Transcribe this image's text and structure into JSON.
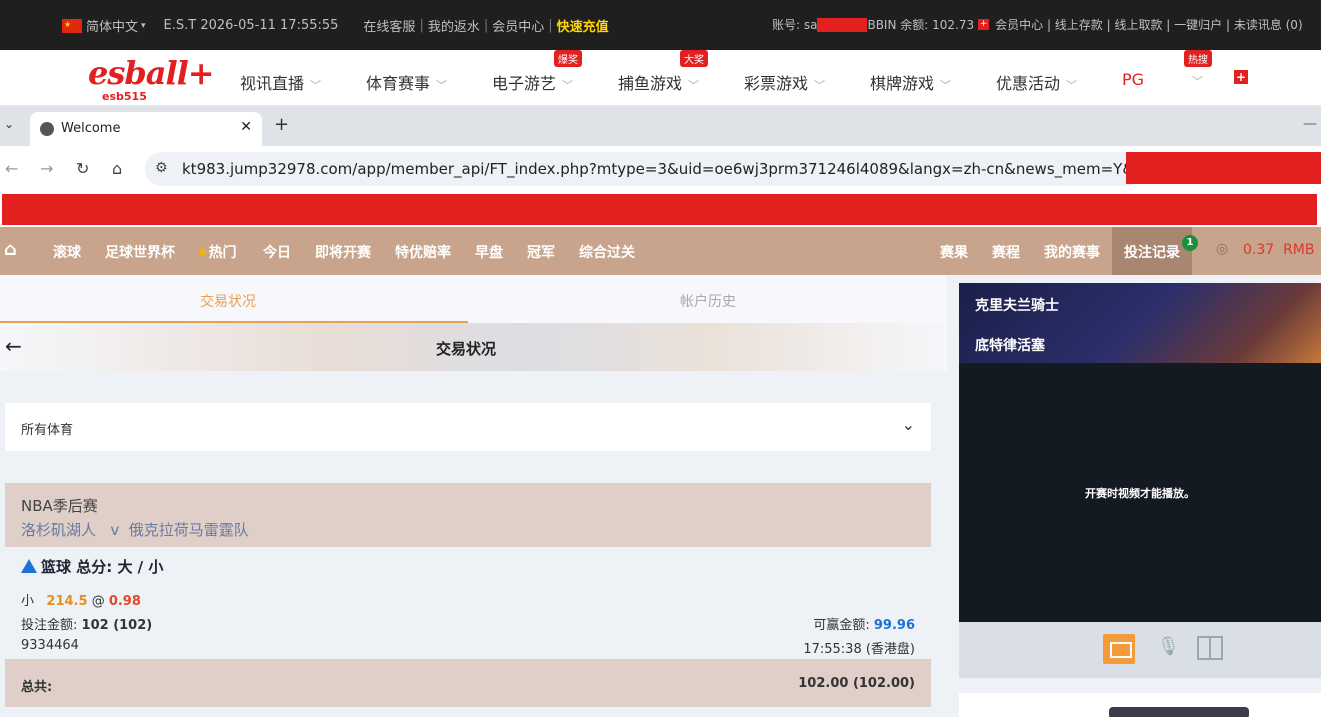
{
  "topbar": {
    "lang": "简体中文",
    "datetime": "E.S.T 2026-05-11 17:55:55",
    "links": [
      "在线客服",
      "我的返水",
      "会员中心"
    ],
    "recharge": "快速充值",
    "account_label": "账号: sa",
    "balance": "BBIN 余额: 102.73",
    "right_links": "会员中心 | 线上存款 | 线上取款 | 一键归户 | 未读讯息 (0)"
  },
  "mainnav": {
    "logo": "esball+",
    "logo_sub": "esb515",
    "items": [
      {
        "label": "视讯直播",
        "badge": ""
      },
      {
        "label": "体育赛事",
        "badge": ""
      },
      {
        "label": "电子游艺",
        "badge": "爆奖"
      },
      {
        "label": "捕鱼游戏",
        "badge": "大奖"
      },
      {
        "label": "彩票游戏",
        "badge": ""
      },
      {
        "label": "棋牌游戏",
        "badge": ""
      },
      {
        "label": "优惠活动",
        "badge": ""
      },
      {
        "label": "PG",
        "badge": ""
      },
      {
        "label": "",
        "badge": "热搜"
      }
    ]
  },
  "browser": {
    "tab_title": "Welcome",
    "url": "kt983.jump32978.com/app/member_api/FT_index.php?mtype=3&uid=oe6wj3prm371246l4089&langx=zh-cn&news_mem=Y&news_api=..."
  },
  "sportnav": {
    "items": [
      "滚球",
      "足球世界杯",
      "热门",
      "今日",
      "即将开赛",
      "特优赔率",
      "早盘",
      "冠军",
      "综合过关"
    ],
    "right": [
      "赛果",
      "赛程",
      "我的赛事",
      "投注记录"
    ],
    "bet_count": "1",
    "balance": "0.37",
    "currency": "RMB"
  },
  "subtabs": {
    "active": "交易状况",
    "inactive": "帐户历史"
  },
  "page_title": "交易状况",
  "filter": "所有体育",
  "event": {
    "league": "NBA季后赛",
    "home": "洛杉矶湖人",
    "vs": "v",
    "away": "俄克拉荷马雷霆队"
  },
  "bet": {
    "market": "篮球 总分: 大 / 小",
    "selection": "小",
    "line": "214.5",
    "at": "@",
    "odds": "0.98",
    "stake_label": "投注金额:",
    "stake": "102 (102)",
    "win_label": "可赢金额:",
    "win": "99.96",
    "ticket": "9334464",
    "time": "17:55:38 (香港盘)"
  },
  "total": {
    "label": "总共:",
    "value": "102.00 (102.00)"
  },
  "video": {
    "team1": "克里夫兰骑士",
    "team2": "底特律活塞",
    "message": "开赛时视频才能播放。"
  },
  "colors": {
    "accent": "#e6a055",
    "nav_brown": "#c8a48c",
    "brand_red": "#e32020",
    "odds_blue": "#1a74d6"
  }
}
